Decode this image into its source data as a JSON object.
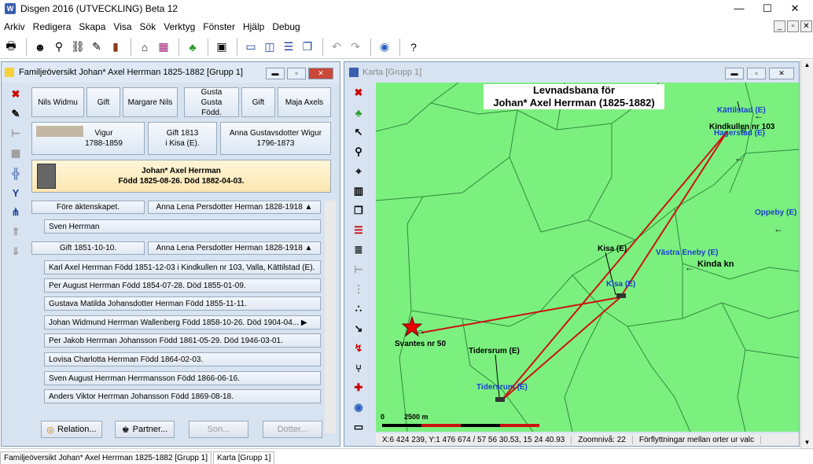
{
  "app": {
    "title": "Disgen 2016 (UTVECKLING) Beta 12"
  },
  "menu": [
    "Arkiv",
    "Redigera",
    "Skapa",
    "Visa",
    "Sök",
    "Verktyg",
    "Fönster",
    "Hjälp",
    "Debug"
  ],
  "family": {
    "title": "Familjeöversikt Johan* Axel Herrman 1825-1882 [Grupp 1]",
    "grandparents": [
      "Nils Widmu",
      "Gift",
      "Margare Nils",
      "Gusta Gusta Född.",
      "Gift",
      "Maja Axels"
    ],
    "father": "Vigur\n1788-1859",
    "parents_marriage": "Gift 1813\ni Kisa (E).",
    "mother": "Anna Gustavsdotter Wigur\n1796-1873",
    "person_name": "Johan* Axel Herrman",
    "person_dates": "Född 1825-08-26. Död 1882-04-03.",
    "marriage1_label": "Före äktenskapet.",
    "spouse1": "Anna Lena Persdotter Herman 1828-1918 ▲",
    "child_pre": "Sven Herrman",
    "marriage2_label": "Gift 1851-10-10.",
    "spouse2": "Anna Lena Persdotter Herman 1828-1918 ▲",
    "children": [
      "Karl Axel Herrman Född 1851-12-03 i Kindkullen nr 103, Valla, Kättilstad (E).",
      "Per August Herrman Född 1854-07-28. Död 1855-01-09.",
      "Gustava Matilda Johansdotter Herman Född 1855-11-11.",
      "Johan Widmund Herrman Wallenberg Född 1858-10-26. Död 1904-04... ▶",
      "Per Jakob Herrman Johansson Född 1861-05-29. Död 1946-03-01.",
      "Lovisa Charlotta Herrman Född 1864-02-03.",
      "Sven August Herrman Herrmansson Född 1866-06-16.",
      "Anders Viktor Herrman Johansson Född 1869-08-18."
    ],
    "buttons": {
      "relation": "Relation...",
      "partner": "Partner...",
      "son": "Son...",
      "dotter": "Dotter..."
    }
  },
  "map": {
    "title": "Karta [Grupp 1]",
    "heading1": "Levnadsbana för",
    "heading2": "Johan* Axel Herrman (1825-1882)",
    "places": {
      "kattilstad": "Kättilstad (E)",
      "kindkullen": "Kindkullen nr 103",
      "hagerstad": "Hagerstad (E)",
      "oppeby": "Oppeby (E)",
      "vastra": "Västra Eneby (E)",
      "kinda": "Kinda kn",
      "kisa_black": "Kisa (E)",
      "kisa_blue": "Kisa (E)",
      "svantes": "Svantes nr 50",
      "tidersrum_black": "Tidersrum (E)",
      "tidersrum_blue": "Tidersrum (E)"
    },
    "scale_zero": "0",
    "scale_label": "2500 m",
    "status": {
      "coords": "X:6 424 239, Y:1 476 674 / 57 56 30.53, 15 24 40.93",
      "zoom": "Zoomnivå: 22",
      "info": "Förflyttningar mellan orter ur valc"
    },
    "colors": {
      "land": "#7cf07f",
      "route": "#cc1111",
      "blue_label": "#1a3fd0"
    }
  },
  "tabs": [
    "Familjeöversikt Johan* Axel Herrman 1825-1882 [Grupp 1]",
    "Karta [Grupp 1]"
  ]
}
